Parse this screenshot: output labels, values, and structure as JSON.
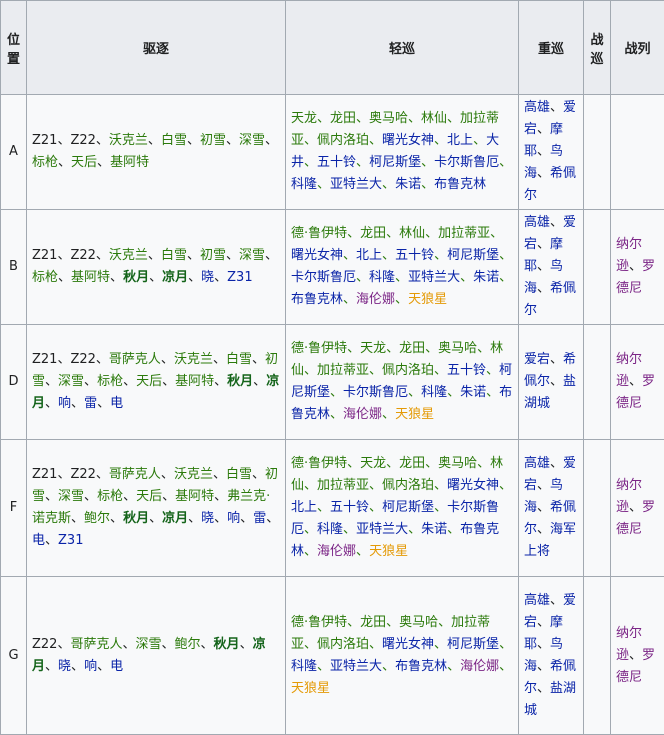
{
  "headers": {
    "position": "位置",
    "destroyer": "驱逐",
    "light_cruiser": "轻巡",
    "heavy_cruiser": "重巡",
    "carrier": "战巡",
    "battleship": "战列"
  },
  "rows": [
    {
      "pos": "A",
      "destroyer": [
        [
          "Z21、Z22、",
          "black"
        ],
        [
          "沃克兰",
          "green"
        ],
        [
          "、",
          "black"
        ],
        [
          "白雪",
          "green"
        ],
        [
          "、",
          "black"
        ],
        [
          "初雪",
          "green"
        ],
        [
          "、",
          "black"
        ],
        [
          "深雪",
          "green"
        ],
        [
          "、",
          "black"
        ],
        [
          "标枪",
          "green"
        ],
        [
          "、",
          "black"
        ],
        [
          "天后",
          "green"
        ],
        [
          "、",
          "black"
        ],
        [
          "基阿特",
          "green"
        ]
      ],
      "light_cruiser": [
        [
          "天龙、龙田、奥马哈、林仙、加拉蒂亚、佩内洛珀、",
          "green"
        ],
        [
          "曙光女神",
          "blue"
        ],
        [
          "、",
          "green"
        ],
        [
          "北上",
          "blue"
        ],
        [
          "、",
          "green"
        ],
        [
          "大井",
          "blue"
        ],
        [
          "、",
          "green"
        ],
        [
          "五十铃",
          "blue"
        ],
        [
          "、",
          "green"
        ],
        [
          "柯尼斯堡",
          "blue"
        ],
        [
          "、",
          "green"
        ],
        [
          "卡尔斯鲁厄",
          "blue"
        ],
        [
          "、",
          "green"
        ],
        [
          "科隆",
          "blue"
        ],
        [
          "、",
          "green"
        ],
        [
          "亚特兰大",
          "blue"
        ],
        [
          "、",
          "green"
        ],
        [
          "朱诺",
          "blue"
        ],
        [
          "、",
          "green"
        ],
        [
          "布鲁克林",
          "blue"
        ]
      ],
      "heavy_cruiser": [
        [
          "高雄",
          "blue"
        ],
        [
          "、",
          "black"
        ],
        [
          "爱宕",
          "blue"
        ],
        [
          "、",
          "black"
        ],
        [
          "摩耶",
          "blue"
        ],
        [
          "、",
          "black"
        ],
        [
          "鸟海",
          "blue"
        ],
        [
          "、",
          "black"
        ],
        [
          "希佩尔",
          "blue"
        ]
      ],
      "carrier": [],
      "battleship": []
    },
    {
      "pos": "B",
      "destroyer": [
        [
          "Z21、Z22、",
          "black"
        ],
        [
          "沃克兰",
          "green"
        ],
        [
          "、",
          "black"
        ],
        [
          "白雪",
          "green"
        ],
        [
          "、",
          "black"
        ],
        [
          "初雪",
          "green"
        ],
        [
          "、",
          "black"
        ],
        [
          "深雪",
          "green"
        ],
        [
          "、",
          "black"
        ],
        [
          "标枪",
          "green"
        ],
        [
          "、",
          "black"
        ],
        [
          "基阿特",
          "green"
        ],
        [
          "、",
          "black"
        ],
        [
          "秋月",
          "darkgreen"
        ],
        [
          "、",
          "black"
        ],
        [
          "凉月",
          "darkgreen"
        ],
        [
          "、",
          "black"
        ],
        [
          "晓",
          "navy"
        ],
        [
          "、",
          "black"
        ],
        [
          "Z31",
          "navy"
        ]
      ],
      "light_cruiser": [
        [
          "德·鲁伊特、龙田、林仙、加拉蒂亚、",
          "green"
        ],
        [
          "曙光女神",
          "blue"
        ],
        [
          "、",
          "green"
        ],
        [
          "北上",
          "blue"
        ],
        [
          "、",
          "green"
        ],
        [
          "五十铃",
          "blue"
        ],
        [
          "、",
          "green"
        ],
        [
          "柯尼斯堡",
          "blue"
        ],
        [
          "、",
          "green"
        ],
        [
          "卡尔斯鲁厄",
          "blue"
        ],
        [
          "、",
          "green"
        ],
        [
          "科隆",
          "blue"
        ],
        [
          "、",
          "green"
        ],
        [
          "亚特兰大",
          "blue"
        ],
        [
          "、",
          "green"
        ],
        [
          "朱诺",
          "blue"
        ],
        [
          "、",
          "green"
        ],
        [
          "布鲁克林",
          "blue"
        ],
        [
          "、",
          "green"
        ],
        [
          "海伦娜",
          "purple"
        ],
        [
          "、",
          "green"
        ],
        [
          "天狼星",
          "orange"
        ]
      ],
      "heavy_cruiser": [
        [
          "高雄",
          "blue"
        ],
        [
          "、",
          "black"
        ],
        [
          "爱宕",
          "blue"
        ],
        [
          "、",
          "black"
        ],
        [
          "摩耶",
          "blue"
        ],
        [
          "、",
          "black"
        ],
        [
          "鸟海",
          "blue"
        ],
        [
          "、",
          "black"
        ],
        [
          "希佩尔",
          "blue"
        ]
      ],
      "carrier": [],
      "battleship": [
        [
          "纳尔逊",
          "purple"
        ],
        [
          "、",
          "black"
        ],
        [
          "罗德尼",
          "purple"
        ]
      ]
    },
    {
      "pos": "D",
      "destroyer": [
        [
          "Z21、Z22、",
          "black"
        ],
        [
          "哥萨克人",
          "green"
        ],
        [
          "、",
          "black"
        ],
        [
          "沃克兰",
          "green"
        ],
        [
          "、",
          "black"
        ],
        [
          "白雪",
          "green"
        ],
        [
          "、",
          "black"
        ],
        [
          "初雪",
          "green"
        ],
        [
          "、",
          "black"
        ],
        [
          "深雪",
          "green"
        ],
        [
          "、",
          "black"
        ],
        [
          "标枪",
          "green"
        ],
        [
          "、",
          "black"
        ],
        [
          "天后",
          "green"
        ],
        [
          "、",
          "black"
        ],
        [
          "基阿特",
          "green"
        ],
        [
          "、",
          "black"
        ],
        [
          "秋月",
          "darkgreen"
        ],
        [
          "、",
          "black"
        ],
        [
          "凉月",
          "darkgreen"
        ],
        [
          "、",
          "black"
        ],
        [
          "响",
          "navy"
        ],
        [
          "、",
          "black"
        ],
        [
          "雷",
          "navy"
        ],
        [
          "、",
          "black"
        ],
        [
          "电",
          "navy"
        ]
      ],
      "light_cruiser": [
        [
          "德·鲁伊特、天龙、龙田、奥马哈、林仙、加拉蒂亚、佩内洛珀、",
          "green"
        ],
        [
          "五十铃",
          "blue"
        ],
        [
          "、",
          "green"
        ],
        [
          "柯尼斯堡",
          "blue"
        ],
        [
          "、",
          "green"
        ],
        [
          "卡尔斯鲁厄",
          "blue"
        ],
        [
          "、",
          "green"
        ],
        [
          "科隆",
          "blue"
        ],
        [
          "、",
          "green"
        ],
        [
          "朱诺",
          "blue"
        ],
        [
          "、",
          "green"
        ],
        [
          "布鲁克林",
          "blue"
        ],
        [
          "、",
          "green"
        ],
        [
          "海伦娜",
          "purple"
        ],
        [
          "、",
          "green"
        ],
        [
          "天狼星",
          "orange"
        ]
      ],
      "heavy_cruiser": [
        [
          "爱宕",
          "blue"
        ],
        [
          "、",
          "black"
        ],
        [
          "希佩尔",
          "blue"
        ],
        [
          "、",
          "black"
        ],
        [
          "盐湖城",
          "blue"
        ]
      ],
      "carrier": [],
      "battleship": [
        [
          "纳尔逊",
          "purple"
        ],
        [
          "、",
          "black"
        ],
        [
          "罗德尼",
          "purple"
        ]
      ]
    },
    {
      "pos": "F",
      "destroyer": [
        [
          "Z21、Z22、",
          "black"
        ],
        [
          "哥萨克人",
          "green"
        ],
        [
          "、",
          "black"
        ],
        [
          "沃克兰",
          "green"
        ],
        [
          "、",
          "black"
        ],
        [
          "白雪",
          "green"
        ],
        [
          "、",
          "black"
        ],
        [
          "初雪",
          "green"
        ],
        [
          "、",
          "black"
        ],
        [
          "深雪",
          "green"
        ],
        [
          "、",
          "black"
        ],
        [
          "标枪",
          "green"
        ],
        [
          "、",
          "black"
        ],
        [
          "天后",
          "green"
        ],
        [
          "、",
          "black"
        ],
        [
          "基阿特",
          "green"
        ],
        [
          "、",
          "black"
        ],
        [
          "弗兰克·诺克斯",
          "green"
        ],
        [
          "、",
          "black"
        ],
        [
          "鲍尔",
          "green"
        ],
        [
          "、",
          "black"
        ],
        [
          "秋月",
          "darkgreen"
        ],
        [
          "、",
          "black"
        ],
        [
          "凉月",
          "darkgreen"
        ],
        [
          "、",
          "black"
        ],
        [
          "晓",
          "navy"
        ],
        [
          "、",
          "black"
        ],
        [
          "响",
          "navy"
        ],
        [
          "、",
          "black"
        ],
        [
          "雷",
          "navy"
        ],
        [
          "、",
          "black"
        ],
        [
          "电",
          "navy"
        ],
        [
          "、",
          "black"
        ],
        [
          "Z31",
          "navy"
        ]
      ],
      "light_cruiser": [
        [
          "德·鲁伊特、天龙、龙田、奥马哈、林仙、加拉蒂亚、佩内洛珀、",
          "green"
        ],
        [
          "曙光女神",
          "blue"
        ],
        [
          "、",
          "green"
        ],
        [
          "北上",
          "blue"
        ],
        [
          "、",
          "green"
        ],
        [
          "五十铃",
          "blue"
        ],
        [
          "、",
          "green"
        ],
        [
          "柯尼斯堡",
          "blue"
        ],
        [
          "、",
          "green"
        ],
        [
          "卡尔斯鲁厄",
          "blue"
        ],
        [
          "、",
          "green"
        ],
        [
          "科隆",
          "blue"
        ],
        [
          "、",
          "green"
        ],
        [
          "亚特兰大",
          "blue"
        ],
        [
          "、",
          "green"
        ],
        [
          "朱诺",
          "blue"
        ],
        [
          "、",
          "green"
        ],
        [
          "布鲁克林",
          "blue"
        ],
        [
          "、",
          "green"
        ],
        [
          "海伦娜",
          "purple"
        ],
        [
          "、",
          "green"
        ],
        [
          "天狼星",
          "orange"
        ]
      ],
      "heavy_cruiser": [
        [
          "高雄",
          "blue"
        ],
        [
          "、",
          "black"
        ],
        [
          "爱宕",
          "blue"
        ],
        [
          "、",
          "black"
        ],
        [
          "鸟海",
          "blue"
        ],
        [
          "、",
          "black"
        ],
        [
          "希佩尔",
          "blue"
        ],
        [
          "、",
          "black"
        ],
        [
          "海军上将",
          "blue"
        ]
      ],
      "carrier": [],
      "battleship": [
        [
          "纳尔逊",
          "purple"
        ],
        [
          "、",
          "black"
        ],
        [
          "罗德尼",
          "purple"
        ]
      ]
    },
    {
      "pos": "G",
      "destroyer": [
        [
          "Z22、",
          "black"
        ],
        [
          "哥萨克人",
          "green"
        ],
        [
          "、",
          "black"
        ],
        [
          "深雪",
          "green"
        ],
        [
          "、",
          "black"
        ],
        [
          "鲍尔",
          "green"
        ],
        [
          "、",
          "black"
        ],
        [
          "秋月",
          "darkgreen"
        ],
        [
          "、",
          "black"
        ],
        [
          "凉月",
          "darkgreen"
        ],
        [
          "、",
          "black"
        ],
        [
          "晓",
          "navy"
        ],
        [
          "、",
          "black"
        ],
        [
          "响",
          "navy"
        ],
        [
          "、",
          "black"
        ],
        [
          "电",
          "navy"
        ]
      ],
      "light_cruiser": [
        [
          "德·鲁伊特、龙田、奥马哈、加拉蒂亚、佩内洛珀、",
          "green"
        ],
        [
          "曙光女神",
          "blue"
        ],
        [
          "、",
          "green"
        ],
        [
          "柯尼斯堡",
          "blue"
        ],
        [
          "、",
          "green"
        ],
        [
          "科隆",
          "blue"
        ],
        [
          "、",
          "green"
        ],
        [
          "亚特兰大",
          "blue"
        ],
        [
          "、",
          "green"
        ],
        [
          "布鲁克林",
          "blue"
        ],
        [
          "、",
          "green"
        ],
        [
          "海伦娜",
          "purple"
        ],
        [
          "、",
          "green"
        ],
        [
          "天狼星",
          "orange"
        ]
      ],
      "heavy_cruiser": [
        [
          "高雄",
          "blue"
        ],
        [
          "、",
          "black"
        ],
        [
          "爱宕",
          "blue"
        ],
        [
          "、",
          "black"
        ],
        [
          "摩耶",
          "blue"
        ],
        [
          "、",
          "black"
        ],
        [
          "鸟海",
          "blue"
        ],
        [
          "、",
          "black"
        ],
        [
          "希佩尔",
          "blue"
        ],
        [
          "、",
          "black"
        ],
        [
          "盐湖城",
          "blue"
        ]
      ],
      "carrier": [],
      "battleship": [
        [
          "纳尔逊",
          "purple"
        ],
        [
          "、",
          "black"
        ],
        [
          "罗德尼",
          "purple"
        ]
      ]
    }
  ]
}
